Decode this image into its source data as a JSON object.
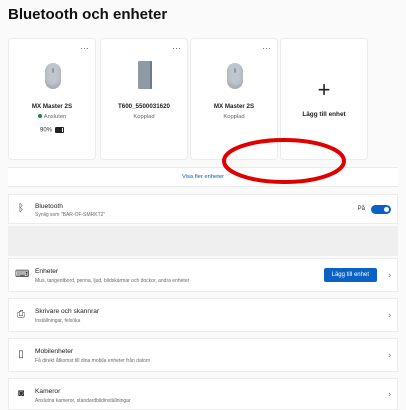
{
  "title": "Bluetooth och enheter",
  "devices": [
    {
      "name": "MX Master 2S",
      "status": "Ansluten",
      "connected": true,
      "battery": "90%",
      "battery_level": 0.9,
      "icon": "mouse-icon"
    },
    {
      "name": "T600_5500031620",
      "status": "Kopplad",
      "connected": false,
      "icon": "tablet-icon"
    },
    {
      "name": "MX Master 2S",
      "status": "Kopplad",
      "connected": false,
      "icon": "mouse-icon"
    }
  ],
  "add_device_card": {
    "label": "Lägg till enhet",
    "icon": "plus-icon"
  },
  "more_icon": "more-icon",
  "show_more": "Visa fler enheter",
  "bluetooth": {
    "title": "Bluetooth",
    "subtitle": "Synlig som \"BAR-OF-SMRKT2\"",
    "toggle_label": "På",
    "enabled": true
  },
  "rows": [
    {
      "title": "Enheter",
      "subtitle": "Mus, tangentbord, penna, ljud, bildskärmar och dockor, andra enheter",
      "button": "Lägg till enhet",
      "icon": "keyboard-icon"
    },
    {
      "title": "Skrivare och skannrar",
      "subtitle": "Inställningar, felsöka",
      "icon": "printer-icon"
    },
    {
      "title": "Mobilenheter",
      "subtitle": "Få direkt åtkomst till dina mobila enheter från datorn",
      "icon": "phone-icon"
    },
    {
      "title": "Kameror",
      "subtitle": "Anslutna kameror, standardbildinställningar",
      "icon": "camera-icon"
    }
  ],
  "annotation_color": "#e00000",
  "accent": "#0a63c4"
}
